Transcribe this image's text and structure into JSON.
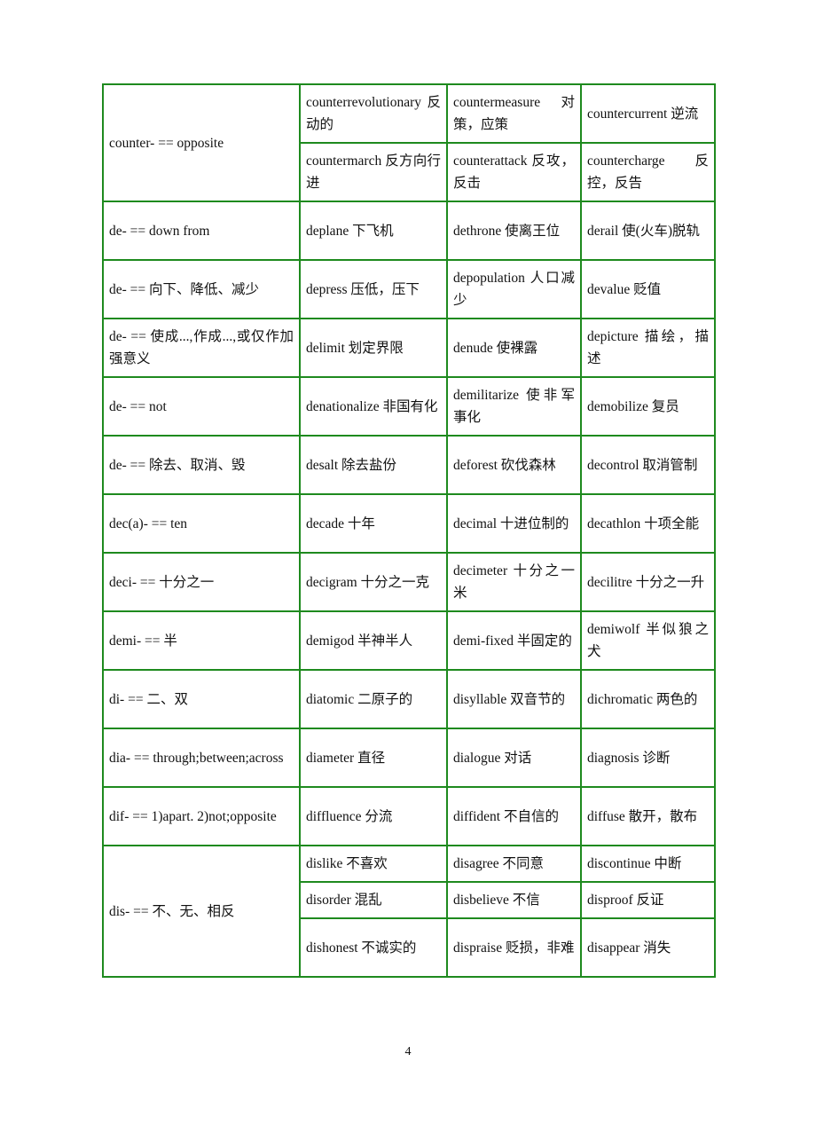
{
  "document": {
    "page_number": "4",
    "border_color": "#1e8a1e",
    "rows": [
      {
        "prefix": "counter- == opposite",
        "groups": [
          [
            "counterrevolutionary 反动的",
            "countermeasure 对策，应策",
            "countercurrent 逆流"
          ],
          [
            "countermarch 反方向行进",
            "counterattack 反攻，反击",
            "countercharge 反控，反告"
          ]
        ]
      },
      {
        "prefix": "de- == down from",
        "groups": [
          [
            "deplane 下飞机",
            "dethrone 使离王位",
            "derail 使(火车)脱轨"
          ]
        ]
      },
      {
        "prefix": "de- == 向下、降低、减少",
        "groups": [
          [
            "depress 压低，压下",
            "depopulation 人口减少",
            "devalue 贬值"
          ]
        ]
      },
      {
        "prefix": "de- == 使成...,作成...,或仅作加强意义",
        "groups": [
          [
            "delimit 划定界限",
            "denude 使裸露",
            "depicture 描绘，描述"
          ]
        ]
      },
      {
        "prefix": "de- == not",
        "groups": [
          [
            "denationalize 非国有化",
            "demilitarize 使非军事化",
            "demobilize 复员"
          ]
        ]
      },
      {
        "prefix": "de- == 除去、取消、毁",
        "groups": [
          [
            "desalt 除去盐份",
            "deforest 砍伐森林",
            "decontrol 取消管制"
          ]
        ]
      },
      {
        "prefix": "dec(a)- == ten",
        "groups": [
          [
            "decade 十年",
            "decimal 十进位制的",
            "decathlon 十项全能"
          ]
        ]
      },
      {
        "prefix": "deci- == 十分之一",
        "groups": [
          [
            "decigram 十分之一克",
            "decimeter 十分之一米",
            "decilitre 十分之一升"
          ]
        ]
      },
      {
        "prefix": "demi- == 半",
        "groups": [
          [
            "demigod 半神半人",
            "demi-fixed 半固定的",
            "demiwolf 半似狼之犬"
          ]
        ]
      },
      {
        "prefix": "di- == 二、双",
        "groups": [
          [
            "diatomic 二原子的",
            "disyllable 双音节的",
            "dichromatic 两色的"
          ]
        ]
      },
      {
        "prefix": "dia- == through;between;across",
        "groups": [
          [
            "diameter 直径",
            "dialogue 对话",
            "diagnosis 诊断"
          ]
        ]
      },
      {
        "prefix": "dif- == 1)apart. 2)not;opposite",
        "groups": [
          [
            "diffluence 分流",
            "diffident 不自信的",
            "diffuse 散开，散布"
          ]
        ]
      },
      {
        "prefix": "dis- == 不、无、相反",
        "groups": [
          [
            "dislike 不喜欢",
            "disagree 不同意",
            "discontinue 中断"
          ],
          [
            "disorder 混乱",
            "disbelieve 不信",
            "disproof 反证"
          ],
          [
            "dishonest 不诚实的",
            "dispraise 贬损，非难",
            "disappear 消失"
          ]
        ]
      }
    ]
  }
}
